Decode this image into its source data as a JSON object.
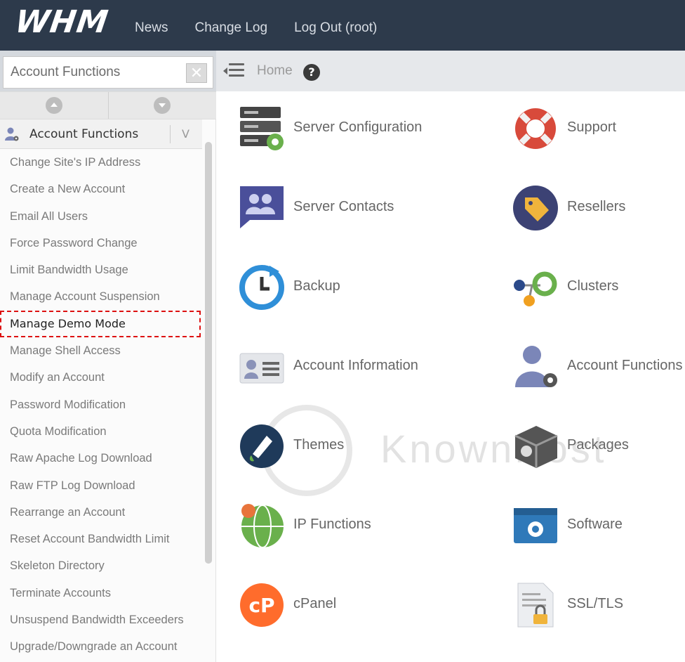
{
  "topbar": {
    "logo": "WHM",
    "nav": [
      "News",
      "Change Log",
      "Log Out (root)"
    ]
  },
  "sidebar": {
    "search": {
      "value": "Account Functions"
    },
    "section": {
      "label": "Account Functions",
      "caret": "V"
    },
    "items": [
      "Change Site's IP Address",
      "Create a New Account",
      "Email All Users",
      "Force Password Change",
      "Limit Bandwidth Usage",
      "Manage Account Suspension",
      "Manage Demo Mode",
      "Manage Shell Access",
      "Modify an Account",
      "Password Modification",
      "Quota Modification",
      "Raw Apache Log Download",
      "Raw FTP Log Download",
      "Rearrange an Account",
      "Reset Account Bandwidth Limit",
      "Skeleton Directory",
      "Terminate Accounts",
      "Unsuspend Bandwidth Exceeders",
      "Upgrade/Downgrade an Account"
    ],
    "highlighted_index": 6
  },
  "breadcrumb": {
    "home": "Home",
    "help": "?"
  },
  "grid": {
    "left": [
      {
        "label": "Server Configuration",
        "icon": "server-gear-icon"
      },
      {
        "label": "Server Contacts",
        "icon": "contacts-icon"
      },
      {
        "label": "Backup",
        "icon": "backup-clock-icon"
      },
      {
        "label": "Account Information",
        "icon": "id-card-icon"
      },
      {
        "label": "Themes",
        "icon": "paint-brush-icon"
      },
      {
        "label": "IP Functions",
        "icon": "globe-icon"
      },
      {
        "label": "cPanel",
        "icon": "cpanel-icon"
      }
    ],
    "right": [
      {
        "label": "Support",
        "icon": "lifebuoy-icon"
      },
      {
        "label": "Resellers",
        "icon": "tag-icon"
      },
      {
        "label": "Clusters",
        "icon": "clusters-icon"
      },
      {
        "label": "Account Functions",
        "icon": "user-gear-icon"
      },
      {
        "label": "Packages",
        "icon": "package-icon"
      },
      {
        "label": "Software",
        "icon": "software-window-icon"
      },
      {
        "label": "SSL/TLS",
        "icon": "certificate-lock-icon"
      }
    ]
  },
  "watermark": {
    "text": "KnownHost"
  },
  "colors": {
    "topbar": "#2d3a4b",
    "highlight_border": "#dd1111"
  }
}
